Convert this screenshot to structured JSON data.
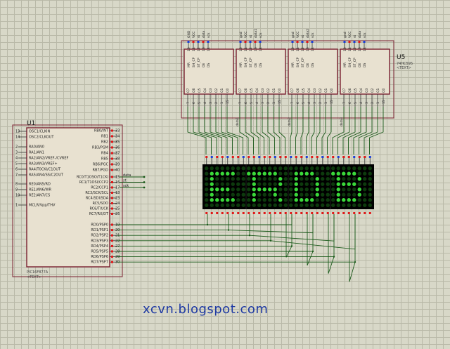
{
  "watermark": "xcvn.blogspot.com",
  "colors": {
    "grid_bg": "#d8d8c8",
    "chip_outline": "#7a2030",
    "wire": "#1a5a1a",
    "led_on": "#3ad83a",
    "led_off": "#0d3a0d",
    "matrix_bg": "#000000",
    "pin_red": "#e01818",
    "pin_blue": "#1c3fd8",
    "watermark": "#1f3aa3"
  },
  "mcu": {
    "ref": "U1",
    "part": "PIC16F877A",
    "text_tag": "<TEXT>",
    "left_pins": [
      {
        "num": "13",
        "name": "OSC1/CLKIN"
      },
      {
        "num": "14",
        "name": "OSC2/CLKOUT"
      },
      {
        "num": "2",
        "name": "RA0/AN0"
      },
      {
        "num": "3",
        "name": "RA1/AN1"
      },
      {
        "num": "4",
        "name": "RA2/AN2/VREF-/CVREF"
      },
      {
        "num": "5",
        "name": "RA3/AN3/VREF+"
      },
      {
        "num": "6",
        "name": "RA4/T0CKI/C1OUT"
      },
      {
        "num": "7",
        "name": "RA5/AN4/SS/C2OUT"
      },
      {
        "num": "8",
        "name": "RE0/AN5/RD"
      },
      {
        "num": "9",
        "name": "RE1/AN6/WR"
      },
      {
        "num": "10",
        "name": "RE2/AN7/CS"
      },
      {
        "num": "1",
        "name": "MCLR/Vpp/THV"
      }
    ],
    "right_pins": [
      {
        "num": "33",
        "name": "RB0/INT"
      },
      {
        "num": "34",
        "name": "RB1"
      },
      {
        "num": "35",
        "name": "RB2"
      },
      {
        "num": "36",
        "name": "RB3/PGM"
      },
      {
        "num": "37",
        "name": "RB4"
      },
      {
        "num": "38",
        "name": "RB5"
      },
      {
        "num": "39",
        "name": "RB6/PGC"
      },
      {
        "num": "40",
        "name": "RB7/PGD"
      },
      {
        "num": "15",
        "name": "RC0/T1OSO/T1CKI"
      },
      {
        "num": "16",
        "name": "RC1/T1OSI/CCP2"
      },
      {
        "num": "17",
        "name": "RC2/CCP1"
      },
      {
        "num": "18",
        "name": "RC3/SCK/SCL"
      },
      {
        "num": "23",
        "name": "RC4/SDI/SDA"
      },
      {
        "num": "24",
        "name": "RC5/SDO"
      },
      {
        "num": "25",
        "name": "RC6/TX/CK"
      },
      {
        "num": "26",
        "name": "RC7/RX/DT"
      },
      {
        "num": "19",
        "name": "RD0/PSP0"
      },
      {
        "num": "20",
        "name": "RD1/PSP1"
      },
      {
        "num": "21",
        "name": "RD2/PSP2"
      },
      {
        "num": "22",
        "name": "RD3/PSP3"
      },
      {
        "num": "27",
        "name": "RD4/PSP4"
      },
      {
        "num": "28",
        "name": "RD5/PSP5"
      },
      {
        "num": "29",
        "name": "RD6/PSP6"
      },
      {
        "num": "30",
        "name": "RD7/PSP7"
      }
    ],
    "net_labels": [
      "data",
      "st",
      "sck"
    ]
  },
  "shift_registers": {
    "ref": "U5",
    "part": "74HC595",
    "text_tag": "<TEXT>",
    "left_pin_names": [
      "MR",
      "SH_CP",
      "ST_CP",
      "OE",
      "DS"
    ],
    "right_pin_names": [
      "Q7'"
    ],
    "output_names": [
      "Q7",
      "Q6",
      "Q5",
      "Q4",
      "Q3",
      "Q2",
      "Q1",
      "Q0"
    ],
    "top_pin_numbers": [
      "10",
      "11",
      "12",
      "13",
      "14"
    ],
    "bottom_pin_numbers": [
      "7",
      "6",
      "5",
      "4",
      "3",
      "2",
      "1",
      "15",
      "9"
    ],
    "chips": [
      {
        "top_labels": [
          "GND",
          "VCC",
          "st",
          "data",
          "sck"
        ]
      },
      {
        "top_labels": [
          "gnd",
          "VCC",
          "st",
          "data1",
          "sck"
        ]
      },
      {
        "top_labels": [
          "gnd",
          "VCC",
          "st",
          "data2",
          "sck"
        ]
      },
      {
        "top_labels": [
          "gnd",
          "VCC",
          "st",
          "data",
          "sck"
        ]
      }
    ],
    "bottom_net_labels": [
      "data1",
      "data2",
      "data3"
    ]
  },
  "matrix": {
    "modules": 4,
    "rows": 8,
    "cols": 8,
    "pattern": [
      "00000000000000000000000000000000",
      "01111100111111000111100011111000",
      "01000000010000100100010001000100",
      "01000000010000100100010001111000",
      "01111000011111000100010001000100",
      "01000000010001000100010001000100",
      "01111100010000100111100001111000",
      "00000000000000000000000000000000"
    ]
  }
}
